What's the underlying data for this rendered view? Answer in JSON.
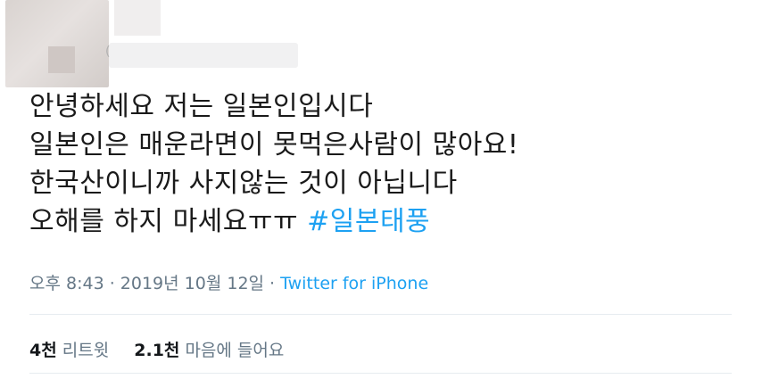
{
  "tweet": {
    "lines": [
      "안녕하세요 저는 일본인입시다",
      "일본인은 매운라면이 못먹은사람이 많아요!",
      "한국산이니까 사지않는 것이 아닙니다",
      "오해를 하지 마세요ㅠㅠ"
    ],
    "hashtag": "#일본태풍"
  },
  "meta": {
    "timestamp": "오후 8:43 · 2019년 10월 12일",
    "separator": " · ",
    "source": "Twitter for iPhone"
  },
  "stats": {
    "retweets_count": "4천",
    "retweets_label": "리트윗",
    "likes_count": "2.1천",
    "likes_label": "마음에 들어요"
  },
  "author": {
    "handle_paren": "("
  }
}
